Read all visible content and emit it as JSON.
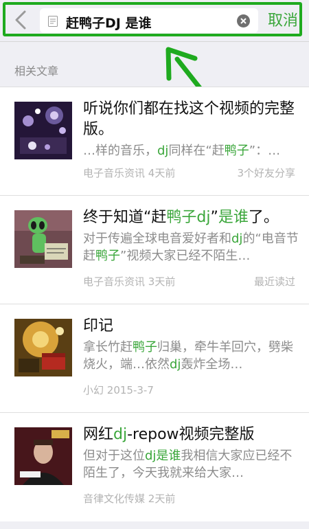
{
  "search": {
    "query": "赶鸭子DJ 是谁",
    "cancel_label": "取消"
  },
  "section_label": "相关文章",
  "colors": {
    "accent": "#3aa63a",
    "highlight_box": "#1faa1f"
  },
  "articles": [
    {
      "title_parts": [
        "听说你们都在找这个视频的完整版。"
      ],
      "summary_parts": [
        "…样的音乐，",
        "dj",
        "同样在“赶",
        "鸭子",
        "”：…"
      ],
      "source": "电子音乐资讯",
      "time": "4天前",
      "extra": "3个好友分享"
    },
    {
      "title_parts": [
        "终于知道“赶",
        "鸭子dj",
        "”",
        "是谁",
        "了。"
      ],
      "summary_parts": [
        "对于传遍全球电音爱好者和",
        "dj",
        "的“电音节赶",
        "鸭子",
        "”视频大家已经不陌生…"
      ],
      "source": "电子音乐资讯",
      "time": "3天前",
      "extra": "最近读过"
    },
    {
      "title_parts": [
        "印记"
      ],
      "summary_parts": [
        "拿长竹赶",
        "鸭子",
        "归巢，牵牛羊回穴，劈柴烧火，端…依然",
        "dj",
        "轰炸全场…"
      ],
      "source": "小幻",
      "time": "2015-3-7",
      "extra": ""
    },
    {
      "title_parts": [
        "网红",
        "dj",
        "-repow视频完整版"
      ],
      "summary_parts": [
        "但对于这位",
        "dj是谁",
        "我相信大家应已经不陌生了，今天我就来给大家…"
      ],
      "source": "音律文化传媒",
      "time": "2天前",
      "extra": ""
    }
  ]
}
